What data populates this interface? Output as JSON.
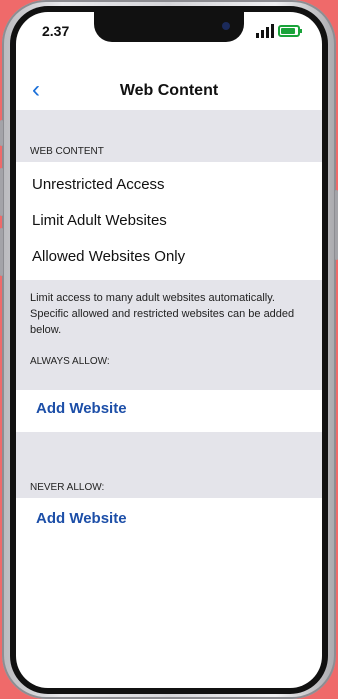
{
  "status": {
    "time": "2.37"
  },
  "nav": {
    "title": "Web Content"
  },
  "web_content": {
    "header": "WEB CONTENT",
    "options": [
      "Unrestricted Access",
      "Limit Adult Websites",
      "Allowed Websites Only"
    ]
  },
  "note": "Limit access to many adult websites automatically. Specific allowed and restricted websites can be added below.",
  "always_allow": {
    "header": "ALWAYS ALLOW:",
    "add_label": "Add Website"
  },
  "never_allow": {
    "header": "NEVER ALLOW:",
    "add_label": "Add Website"
  },
  "colors": {
    "accent": "#1a6fd8",
    "link": "#1d4fa8",
    "section_bg": "#e4e4ea",
    "backdrop": "#ef6a6a"
  }
}
